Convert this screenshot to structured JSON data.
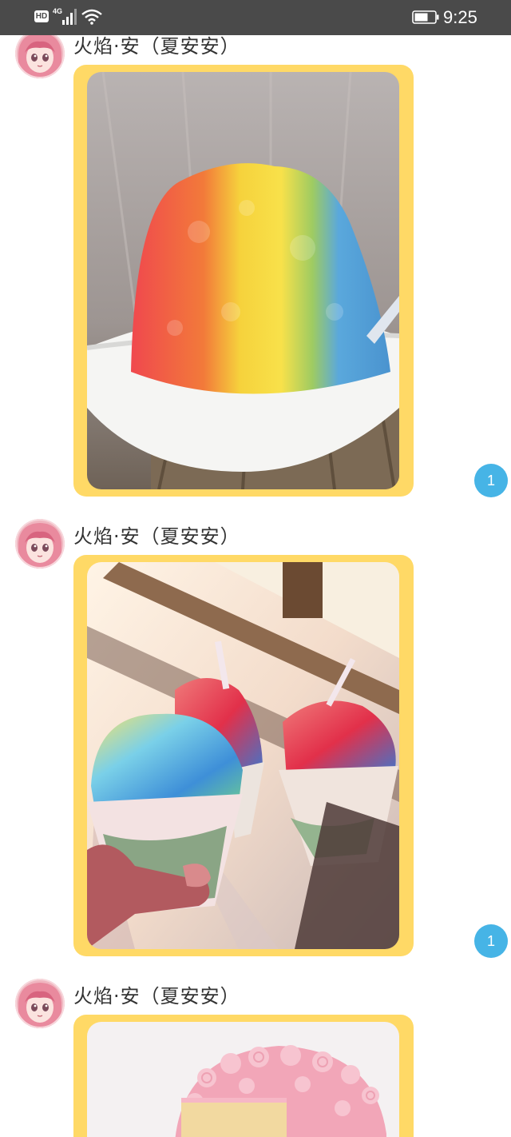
{
  "status_bar": {
    "hd_label": "HD",
    "network_label": "4G",
    "time": "9:25",
    "icons": [
      "hd-badge-icon",
      "signal-icon",
      "wifi-icon",
      "battery-icon"
    ],
    "bar_color": "#4a4a4a"
  },
  "messages": [
    {
      "sender": "火焰·安（夏安安）",
      "avatar_icon": "anime-girl-avatar-icon",
      "image": "rainbow-shaved-ice-in-bowl",
      "unread_count": "1"
    },
    {
      "sender": "火焰·安（夏安安）",
      "avatar_icon": "anime-girl-avatar-icon",
      "image": "three-shaved-ice-cups-toast",
      "unread_count": "1"
    },
    {
      "sender": "火焰·安（夏安安）",
      "avatar_icon": "anime-girl-avatar-icon",
      "image": "pink-frosted-layer-cake"
    }
  ],
  "colors": {
    "bubble": "#ffd966",
    "badge": "#46b4e6",
    "name_text": "#333333"
  }
}
